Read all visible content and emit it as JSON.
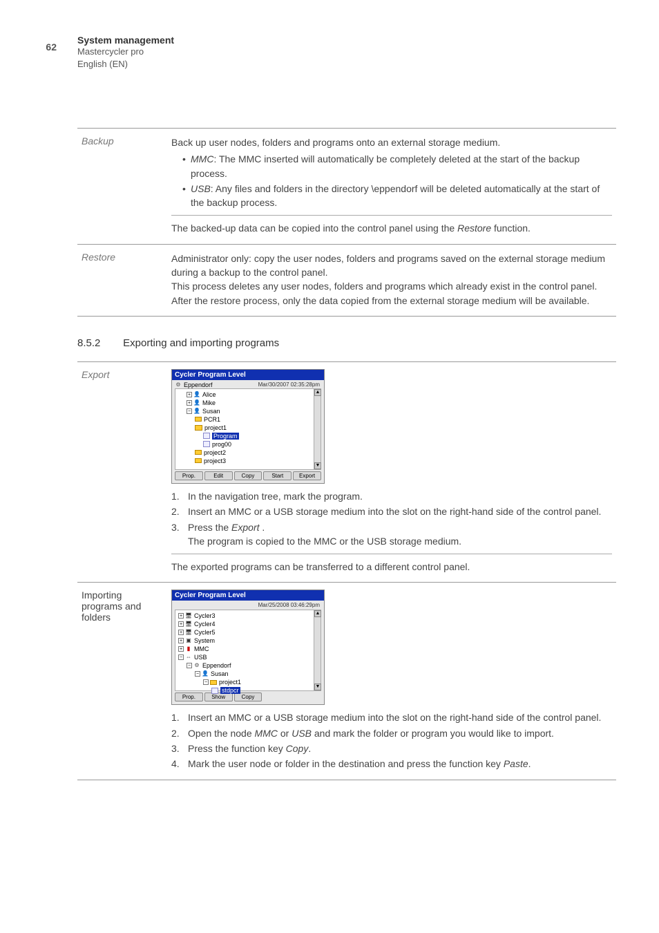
{
  "page": {
    "number": "62"
  },
  "header": {
    "title": "System management",
    "sub1": "Mastercycler pro",
    "sub2": "English (EN)"
  },
  "table1": {
    "rows": [
      {
        "label": "Backup",
        "intro": "Back up user nodes, folders and programs onto an external storage medium.",
        "bullets": [
          {
            "prefix": "MMC",
            "text": ": The MMC inserted will automatically be completely deleted at the start of the backup process."
          },
          {
            "prefix": "USB",
            "text": ": Any files and folders in the directory \\eppendorf will be deleted automatically at the start of the backup process."
          }
        ],
        "footer_pre": "The backed-up data can be copied into the control panel using the ",
        "footer_em": "Restore",
        "footer_post": " function."
      },
      {
        "label": "Restore",
        "body": "Administrator only: copy the user nodes, folders and programs saved on the external storage medium during a backup to the control panel.\nThis process deletes any user nodes, folders and programs which already exist in the control panel. After the restore process, only the data copied from the external storage medium will be available."
      }
    ]
  },
  "section": {
    "num": "8.5.2",
    "title": "Exporting and importing programs"
  },
  "screenshot1": {
    "title": "Cycler Program Level",
    "root": "Eppendorf",
    "time": "Mar/30/2007 02:35:28pm",
    "nodes": {
      "u1": "Alice",
      "u2": "Mike",
      "u3": "Susan",
      "f1": "PCR1",
      "f2": "project1",
      "p1": "Program",
      "p2": "prog00",
      "f3": "project2",
      "f4": "project3"
    },
    "buttons": {
      "b1": "Prop.",
      "b2": "Edit",
      "b3": "Copy",
      "b4": "Start",
      "b5": "Export"
    }
  },
  "screenshot2": {
    "title": "Cycler Program Level",
    "time": "Mar/25/2008 03:46:29pm",
    "nodes": {
      "d1": "Cycler3",
      "d2": "Cycler4",
      "d3": "Cycler5",
      "sys": "System",
      "mmc": "MMC",
      "usb": "USB",
      "root": "Eppendorf",
      "u1": "Susan",
      "f1": "project1",
      "p1": "stdpcr"
    },
    "buttons": {
      "b1": "Prop.",
      "b2": "Show",
      "b3": "Copy"
    }
  },
  "table2": {
    "rows": [
      {
        "label": "Export",
        "steps": [
          {
            "n": "1.",
            "text": "In the navigation tree, mark the program."
          },
          {
            "n": "2.",
            "text": "Insert an MMC or a USB storage medium into the slot on the right-hand side of the control panel."
          },
          {
            "n": "3.",
            "pre": "Press the ",
            "em": "Export",
            "post": " .",
            "sub": "The program is copied to the MMC or the USB storage medium."
          }
        ],
        "footer": "The exported programs can be transferred to a different control panel."
      },
      {
        "label": "Importing programs and folders",
        "steps": [
          {
            "n": "1.",
            "text": "Insert an MMC or a USB storage medium into the slot on the right-hand side of the control panel."
          },
          {
            "n": "2.",
            "pre": "Open the node ",
            "em1": "MMC",
            "mid": " or ",
            "em2": "USB",
            "post": " and mark the folder or program you would like to import."
          },
          {
            "n": "3.",
            "pre": "Press the function key ",
            "em": "Copy",
            "post": "."
          },
          {
            "n": "4.",
            "pre": "Mark the user node or folder in the destination and press the function key ",
            "em": "Paste",
            "post": "."
          }
        ]
      }
    ]
  }
}
